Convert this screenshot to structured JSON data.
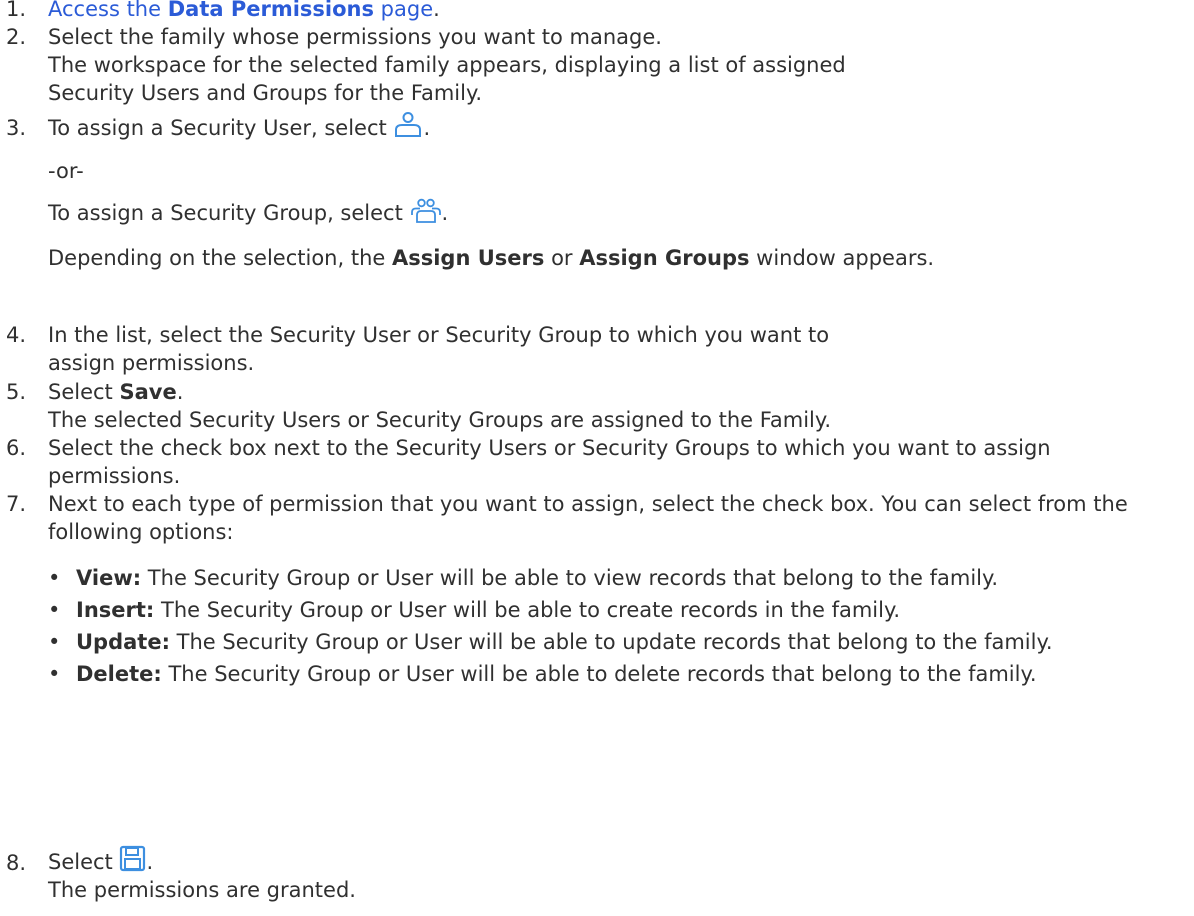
{
  "steps": [
    {
      "num": "1.",
      "link_pre": "Access the ",
      "link_bold": "Data Permissions",
      "link_post": " page",
      "post": "."
    },
    {
      "num": "2.",
      "line1": "Select the family whose permissions you want to manage.",
      "line2": "The workspace for the selected family appears, displaying a list of assigned Security Users and Groups for the Family."
    },
    {
      "num": "3.",
      "user_pre": "To assign a Security User, select ",
      "user_icon": "add-user-icon",
      "or": "-or-",
      "group_pre": "To assign a Security Group, select ",
      "group_icon": "add-group-icon",
      "period": ".",
      "dep_pre": "Depending on the selection, the ",
      "dep_b1": "Assign Users",
      "dep_mid": " or ",
      "dep_b2": "Assign Groups",
      "dep_post": " window appears."
    },
    {
      "num": "4.",
      "text": "In the list, select the Security User or Security Group to which you want to assign permissions."
    },
    {
      "num": "5.",
      "pre": "Select ",
      "bold": "Save",
      "post": ".",
      "line2": "The selected Security Users or Security Groups are assigned to the Family."
    },
    {
      "num": "6.",
      "text": "Select the check box next to the Security Users or Security Groups to which you want to assign permissions."
    },
    {
      "num": "7.",
      "text": "Next to each type of permission that you want to assign, select the check box. You can select from the following options:",
      "options": [
        {
          "label": "View:",
          "desc": " The Security Group or User will be able to view records that belong to the family."
        },
        {
          "label": "Insert:",
          "desc": " The Security Group or User will be able to create records in the family."
        },
        {
          "label": "Update:",
          "desc": " The Security Group or User will be able to update records that belong to the family."
        },
        {
          "label": "Delete:",
          "desc": " The Security Group or User will be able to delete records that belong to the family."
        }
      ]
    },
    {
      "num": "8.",
      "pre": "Select ",
      "icon": "save-icon",
      "post": ".",
      "line2": "The permissions are granted."
    }
  ],
  "colors": {
    "text": "#303030",
    "link": "#2b5bd7",
    "icon": "#3d8fe0"
  }
}
